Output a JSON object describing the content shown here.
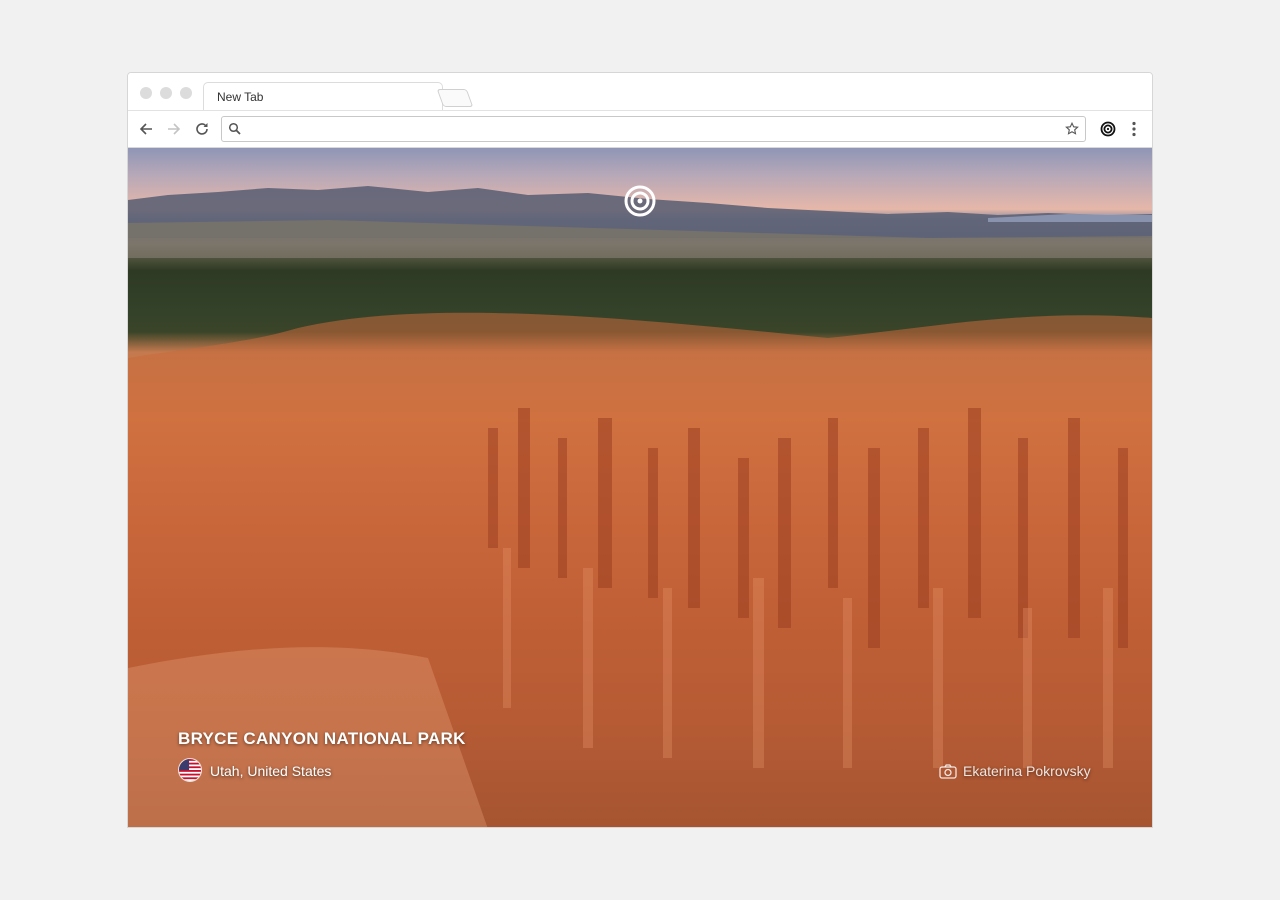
{
  "browser": {
    "tab_title": "New Tab",
    "address_bar": {
      "value": "",
      "placeholder": ""
    },
    "icons": [
      "back-icon",
      "forward-icon",
      "reload-icon",
      "search-icon",
      "star-icon",
      "extension-target-icon",
      "menu-icon"
    ]
  },
  "newtab": {
    "logo_icon": "target-logo-icon",
    "location_title": "BRYCE CANYON NATIONAL PARK",
    "location_subtitle": "Utah, United States",
    "country_flag_icon": "us-flag-icon",
    "photographer": "Ekaterina Pokrovsky",
    "camera_icon": "camera-icon"
  },
  "colors": {
    "page_background": "#f1f1f1",
    "canyon_orange": "#d97a46",
    "sky_pink": "#e6b7a9"
  }
}
